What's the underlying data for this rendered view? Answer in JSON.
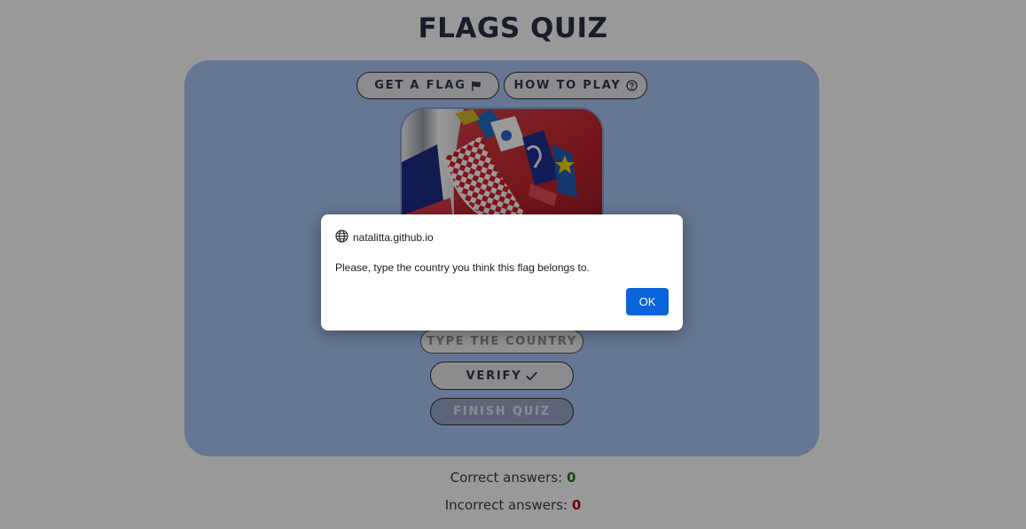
{
  "app": {
    "title": "FLAGS QUIZ"
  },
  "toolbar": {
    "get_flag_label": "GET A FLAG",
    "get_flag_icon": "flag-icon",
    "how_to_play_label": "HOW TO PLAY",
    "how_to_play_icon": "question-circle-icon"
  },
  "flag": {
    "description_icon": "croatia-flag-image"
  },
  "answer": {
    "placeholder": "TYPE THE COUNTRY",
    "value": ""
  },
  "actions": {
    "verify_label": "VERIFY",
    "verify_icon": "checkmark-icon",
    "finish_label": "FINISH QUIZ"
  },
  "score": {
    "correct_label": "Correct answers:",
    "correct_value": "0",
    "incorrect_label": "Incorrect answers:",
    "incorrect_value": "0"
  },
  "dialog": {
    "origin": "natalitta.github.io",
    "origin_icon": "globe-icon",
    "message": "Please, type the country you think this flag belongs to.",
    "ok_label": "OK"
  },
  "colors": {
    "card_background": "#a8c7f4",
    "title": "#2a3146",
    "correct": "#1f7a1f",
    "incorrect": "#b01010",
    "ok_button": "#0b63d9"
  }
}
